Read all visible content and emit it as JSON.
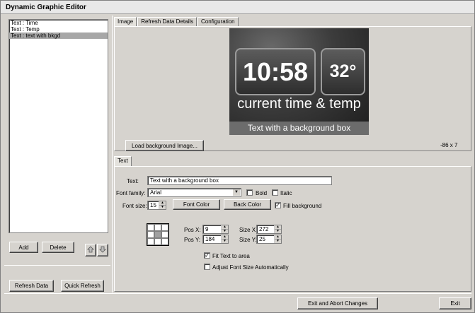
{
  "window": {
    "title": "Dynamic Graphic Editor"
  },
  "list": {
    "items": [
      {
        "label": "Text : Time",
        "selected": false
      },
      {
        "label": "Text : Temp",
        "selected": false
      },
      {
        "label": "Text : text with bkgd",
        "selected": true
      }
    ]
  },
  "left_buttons": {
    "add": "Add",
    "delete": "Delete",
    "move_up_icon": "arrow-up-icon",
    "move_down_icon": "arrow-down-icon",
    "refresh_data": "Refresh Data",
    "quick_refresh": "Quick Refresh"
  },
  "top_tabs": [
    "Image",
    "Refresh Data Details",
    "Configuration"
  ],
  "preview": {
    "time": "10:58",
    "temp": "32°",
    "caption": "current time & temp",
    "box_text": "Text with a background box"
  },
  "image_panel": {
    "load_button": "Load background Image...",
    "coord_readout": "-86 x 7"
  },
  "text_tab": {
    "label": "Text"
  },
  "text_props": {
    "text_label": "Text:",
    "text_value": "Text with a background box",
    "font_family_label": "Font family:",
    "font_family_value": "Arial",
    "bold_label": "Bold",
    "bold_checked": false,
    "italic_label": "Italic",
    "italic_checked": false,
    "font_size_label": "Font size:",
    "font_size_value": "15",
    "font_color_button": "Font Color",
    "back_color_button": "Back Color",
    "fill_bg_label": "Fill background",
    "fill_bg_checked": true,
    "fill_bg_mark": "✓",
    "pos_x_label": "Pos X:",
    "pos_x_value": "9",
    "pos_y_label": "Pos Y:",
    "pos_y_value": "184",
    "size_x_label": "Size X:",
    "size_x_value": "272",
    "size_y_label": "Size Y:",
    "size_y_value": "25",
    "fit_text_label": "Fit Text to area",
    "fit_text_checked": true,
    "fit_text_mark": "✓",
    "adjust_font_label": "Adjust Font Size Automatically",
    "adjust_font_checked": false
  },
  "footer": {
    "exit_abort": "Exit and Abort Changes",
    "exit": "Exit"
  }
}
